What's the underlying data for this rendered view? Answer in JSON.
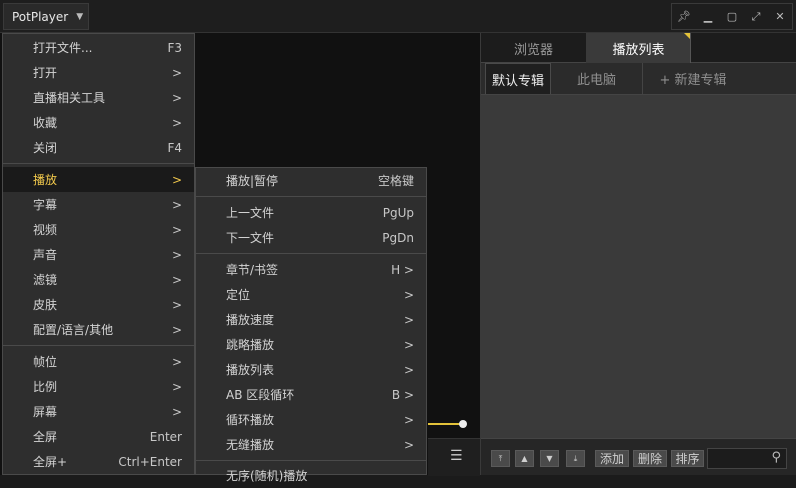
{
  "app": {
    "title": "PotPlayer"
  },
  "window_controls": [
    "pin-icon",
    "minimize-icon",
    "maximize-icon",
    "fullscreen-icon",
    "close-icon"
  ],
  "main_menu": {
    "items": [
      {
        "label": "打开文件...",
        "shortcut": "F3"
      },
      {
        "label": "打开",
        "shortcut": ">"
      },
      {
        "label": "直播相关工具",
        "shortcut": ">"
      },
      {
        "label": "收藏",
        "shortcut": ">"
      },
      {
        "label": "关闭",
        "shortcut": "F4"
      },
      {
        "label": "播放",
        "shortcut": ">"
      },
      {
        "label": "字幕",
        "shortcut": ">"
      },
      {
        "label": "视频",
        "shortcut": ">"
      },
      {
        "label": "声音",
        "shortcut": ">"
      },
      {
        "label": "滤镜",
        "shortcut": ">"
      },
      {
        "label": "皮肤",
        "shortcut": ">"
      },
      {
        "label": "配置/语言/其他",
        "shortcut": ">"
      },
      {
        "label": "帧位",
        "shortcut": ">"
      },
      {
        "label": "比例",
        "shortcut": ">"
      },
      {
        "label": "屏幕",
        "shortcut": ">"
      },
      {
        "label": "全屏",
        "shortcut": "Enter"
      },
      {
        "label": "全屏+",
        "shortcut": "Ctrl+Enter"
      }
    ]
  },
  "sub_menu": {
    "items": [
      {
        "label": "播放|暂停",
        "shortcut": "空格键"
      },
      {
        "label": "上一文件",
        "shortcut": "PgUp"
      },
      {
        "label": "下一文件",
        "shortcut": "PgDn"
      },
      {
        "label": "章节/书签",
        "shortcut": "H >"
      },
      {
        "label": "定位",
        "shortcut": ">"
      },
      {
        "label": "播放速度",
        "shortcut": ">"
      },
      {
        "label": "跳略播放",
        "shortcut": ">"
      },
      {
        "label": "播放列表",
        "shortcut": ">"
      },
      {
        "label": "AB 区段循环",
        "shortcut": "B >"
      },
      {
        "label": "循环播放",
        "shortcut": ">"
      },
      {
        "label": "无缝播放",
        "shortcut": ">"
      },
      {
        "label": "无序(随机)播放",
        "shortcut": ""
      }
    ]
  },
  "panel": {
    "tabs": [
      "浏览器",
      "播放列表"
    ],
    "subtabs": [
      "默认专辑",
      "此电脑",
      "+ 新建专辑"
    ],
    "toolbar": {
      "add": "添加",
      "delete": "删除",
      "sort": "排序"
    }
  },
  "colors": {
    "accent": "#f2c94c",
    "progress": "#e3c23a"
  }
}
